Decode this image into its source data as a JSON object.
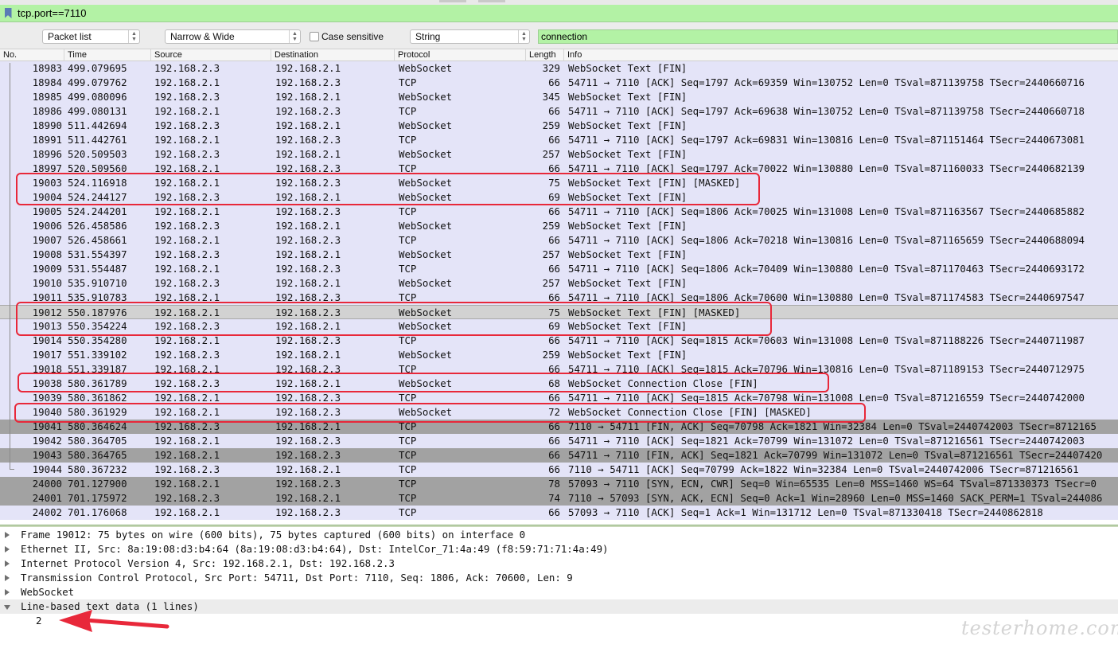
{
  "filter": {
    "value": "tcp.port==7110"
  },
  "findbar": {
    "search_in": "Packet list",
    "char_width": "Narrow & Wide",
    "case_sensitive_label": "Case sensitive",
    "type": "String",
    "search_value": "connection"
  },
  "columns": [
    "No.",
    "Time",
    "Source",
    "Destination",
    "Protocol",
    "Length",
    "Info"
  ],
  "colors": {
    "filter_ok": "#b3f2a5",
    "websocket_row": "#e4e4f8",
    "gray_row": "#a2a2a2",
    "selected_row": "#d2d2d2",
    "annotation": "#e8283a"
  },
  "packets": [
    {
      "no": "18983",
      "time": "499.079695",
      "src": "192.168.2.3",
      "dst": "192.168.2.1",
      "proto": "WebSocket",
      "len": "329",
      "info": "WebSocket Text [FIN]",
      "style": "ws"
    },
    {
      "no": "18984",
      "time": "499.079762",
      "src": "192.168.2.1",
      "dst": "192.168.2.3",
      "proto": "TCP",
      "len": "66",
      "info": "54711 → 7110 [ACK] Seq=1797 Ack=69359 Win=130752 Len=0 TSval=871139758 TSecr=2440660716",
      "style": "ws"
    },
    {
      "no": "18985",
      "time": "499.080096",
      "src": "192.168.2.3",
      "dst": "192.168.2.1",
      "proto": "WebSocket",
      "len": "345",
      "info": "WebSocket Text [FIN]",
      "style": "ws"
    },
    {
      "no": "18986",
      "time": "499.080131",
      "src": "192.168.2.1",
      "dst": "192.168.2.3",
      "proto": "TCP",
      "len": "66",
      "info": "54711 → 7110 [ACK] Seq=1797 Ack=69638 Win=130752 Len=0 TSval=871139758 TSecr=2440660718",
      "style": "ws"
    },
    {
      "no": "18990",
      "time": "511.442694",
      "src": "192.168.2.3",
      "dst": "192.168.2.1",
      "proto": "WebSocket",
      "len": "259",
      "info": "WebSocket Text [FIN]",
      "style": "ws"
    },
    {
      "no": "18991",
      "time": "511.442761",
      "src": "192.168.2.1",
      "dst": "192.168.2.3",
      "proto": "TCP",
      "len": "66",
      "info": "54711 → 7110 [ACK] Seq=1797 Ack=69831 Win=130816 Len=0 TSval=871151464 TSecr=2440673081",
      "style": "ws"
    },
    {
      "no": "18996",
      "time": "520.509503",
      "src": "192.168.2.3",
      "dst": "192.168.2.1",
      "proto": "WebSocket",
      "len": "257",
      "info": "WebSocket Text [FIN]",
      "style": "ws"
    },
    {
      "no": "18997",
      "time": "520.509560",
      "src": "192.168.2.1",
      "dst": "192.168.2.3",
      "proto": "TCP",
      "len": "66",
      "info": "54711 → 7110 [ACK] Seq=1797 Ack=70022 Win=130880 Len=0 TSval=871160033 TSecr=2440682139",
      "style": "ws"
    },
    {
      "no": "19003",
      "time": "524.116918",
      "src": "192.168.2.1",
      "dst": "192.168.2.3",
      "proto": "WebSocket",
      "len": "75",
      "info": "WebSocket Text [FIN] [MASKED]",
      "style": "ws"
    },
    {
      "no": "19004",
      "time": "524.244127",
      "src": "192.168.2.3",
      "dst": "192.168.2.1",
      "proto": "WebSocket",
      "len": "69",
      "info": "WebSocket Text [FIN]",
      "style": "ws"
    },
    {
      "no": "19005",
      "time": "524.244201",
      "src": "192.168.2.1",
      "dst": "192.168.2.3",
      "proto": "TCP",
      "len": "66",
      "info": "54711 → 7110 [ACK] Seq=1806 Ack=70025 Win=131008 Len=0 TSval=871163567 TSecr=2440685882",
      "style": "ws"
    },
    {
      "no": "19006",
      "time": "526.458586",
      "src": "192.168.2.3",
      "dst": "192.168.2.1",
      "proto": "WebSocket",
      "len": "259",
      "info": "WebSocket Text [FIN]",
      "style": "ws"
    },
    {
      "no": "19007",
      "time": "526.458661",
      "src": "192.168.2.1",
      "dst": "192.168.2.3",
      "proto": "TCP",
      "len": "66",
      "info": "54711 → 7110 [ACK] Seq=1806 Ack=70218 Win=130816 Len=0 TSval=871165659 TSecr=2440688094",
      "style": "ws"
    },
    {
      "no": "19008",
      "time": "531.554397",
      "src": "192.168.2.3",
      "dst": "192.168.2.1",
      "proto": "WebSocket",
      "len": "257",
      "info": "WebSocket Text [FIN]",
      "style": "ws"
    },
    {
      "no": "19009",
      "time": "531.554487",
      "src": "192.168.2.1",
      "dst": "192.168.2.3",
      "proto": "TCP",
      "len": "66",
      "info": "54711 → 7110 [ACK] Seq=1806 Ack=70409 Win=130880 Len=0 TSval=871170463 TSecr=2440693172",
      "style": "ws"
    },
    {
      "no": "19010",
      "time": "535.910710",
      "src": "192.168.2.3",
      "dst": "192.168.2.1",
      "proto": "WebSocket",
      "len": "257",
      "info": "WebSocket Text [FIN]",
      "style": "ws"
    },
    {
      "no": "19011",
      "time": "535.910783",
      "src": "192.168.2.1",
      "dst": "192.168.2.3",
      "proto": "TCP",
      "len": "66",
      "info": "54711 → 7110 [ACK] Seq=1806 Ack=70600 Win=130880 Len=0 TSval=871174583 TSecr=2440697547",
      "style": "ws"
    },
    {
      "no": "19012",
      "time": "550.187976",
      "src": "192.168.2.1",
      "dst": "192.168.2.3",
      "proto": "WebSocket",
      "len": "75",
      "info": "WebSocket Text [FIN] [MASKED]",
      "style": "sel"
    },
    {
      "no": "19013",
      "time": "550.354224",
      "src": "192.168.2.3",
      "dst": "192.168.2.1",
      "proto": "WebSocket",
      "len": "69",
      "info": "WebSocket Text [FIN]",
      "style": "ws"
    },
    {
      "no": "19014",
      "time": "550.354280",
      "src": "192.168.2.1",
      "dst": "192.168.2.3",
      "proto": "TCP",
      "len": "66",
      "info": "54711 → 7110 [ACK] Seq=1815 Ack=70603 Win=131008 Len=0 TSval=871188226 TSecr=2440711987",
      "style": "ws"
    },
    {
      "no": "19017",
      "time": "551.339102",
      "src": "192.168.2.3",
      "dst": "192.168.2.1",
      "proto": "WebSocket",
      "len": "259",
      "info": "WebSocket Text [FIN]",
      "style": "ws"
    },
    {
      "no": "19018",
      "time": "551.339187",
      "src": "192.168.2.1",
      "dst": "192.168.2.3",
      "proto": "TCP",
      "len": "66",
      "info": "54711 → 7110 [ACK] Seq=1815 Ack=70796 Win=130816 Len=0 TSval=871189153 TSecr=2440712975",
      "style": "ws"
    },
    {
      "no": "19038",
      "time": "580.361789",
      "src": "192.168.2.3",
      "dst": "192.168.2.1",
      "proto": "WebSocket",
      "len": "68",
      "info": "WebSocket Connection Close [FIN]",
      "style": "ws"
    },
    {
      "no": "19039",
      "time": "580.361862",
      "src": "192.168.2.1",
      "dst": "192.168.2.3",
      "proto": "TCP",
      "len": "66",
      "info": "54711 → 7110 [ACK] Seq=1815 Ack=70798 Win=131008 Len=0 TSval=871216559 TSecr=2440742000",
      "style": "ws"
    },
    {
      "no": "19040",
      "time": "580.361929",
      "src": "192.168.2.1",
      "dst": "192.168.2.3",
      "proto": "WebSocket",
      "len": "72",
      "info": "WebSocket Connection Close [FIN] [MASKED]",
      "style": "ws"
    },
    {
      "no": "19041",
      "time": "580.364624",
      "src": "192.168.2.3",
      "dst": "192.168.2.1",
      "proto": "TCP",
      "len": "66",
      "info": "7110 → 54711 [FIN, ACK] Seq=70798 Ack=1821 Win=32384 Len=0 TSval=2440742003 TSecr=8712165",
      "style": "gray"
    },
    {
      "no": "19042",
      "time": "580.364705",
      "src": "192.168.2.1",
      "dst": "192.168.2.3",
      "proto": "TCP",
      "len": "66",
      "info": "54711 → 7110 [ACK] Seq=1821 Ack=70799 Win=131072 Len=0 TSval=871216561 TSecr=2440742003",
      "style": "ws"
    },
    {
      "no": "19043",
      "time": "580.364765",
      "src": "192.168.2.1",
      "dst": "192.168.2.3",
      "proto": "TCP",
      "len": "66",
      "info": "54711 → 7110 [FIN, ACK] Seq=1821 Ack=70799 Win=131072 Len=0 TSval=871216561 TSecr=24407420",
      "style": "gray"
    },
    {
      "no": "19044",
      "time": "580.367232",
      "src": "192.168.2.3",
      "dst": "192.168.2.1",
      "proto": "TCP",
      "len": "66",
      "info": "7110 → 54711 [ACK] Seq=70799 Ack=1822 Win=32384 Len=0 TSval=2440742006 TSecr=871216561",
      "style": "ws"
    },
    {
      "no": "24000",
      "time": "701.127900",
      "src": "192.168.2.1",
      "dst": "192.168.2.3",
      "proto": "TCP",
      "len": "78",
      "info": "57093 → 7110 [SYN, ECN, CWR] Seq=0 Win=65535 Len=0 MSS=1460 WS=64 TSval=871330373 TSecr=0",
      "style": "gray"
    },
    {
      "no": "24001",
      "time": "701.175972",
      "src": "192.168.2.3",
      "dst": "192.168.2.1",
      "proto": "TCP",
      "len": "74",
      "info": "7110 → 57093 [SYN, ACK, ECN] Seq=0 Ack=1 Win=28960 Len=0 MSS=1460 SACK_PERM=1 TSval=244086",
      "style": "gray"
    },
    {
      "no": "24002",
      "time": "701.176068",
      "src": "192.168.2.1",
      "dst": "192.168.2.3",
      "proto": "TCP",
      "len": "66",
      "info": "57093 → 7110 [ACK] Seq=1 Ack=1 Win=131712 Len=0 TSval=871330418 TSecr=2440862818",
      "style": "ws"
    }
  ],
  "details": [
    {
      "text": "Frame 19012: 75 bytes on wire (600 bits), 75 bytes captured (600 bits) on interface 0",
      "expanded": false
    },
    {
      "text": "Ethernet II, Src: 8a:19:08:d3:b4:64 (8a:19:08:d3:b4:64), Dst: IntelCor_71:4a:49 (f8:59:71:71:4a:49)",
      "expanded": false
    },
    {
      "text": "Internet Protocol Version 4, Src: 192.168.2.1, Dst: 192.168.2.3",
      "expanded": false
    },
    {
      "text": "Transmission Control Protocol, Src Port: 54711, Dst Port: 7110, Seq: 1806, Ack: 70600, Len: 9",
      "expanded": false
    },
    {
      "text": "WebSocket",
      "expanded": false
    },
    {
      "text": "Line-based text data (1 lines)",
      "expanded": true
    }
  ],
  "detail_child": "2",
  "watermark": "testerhome.com"
}
